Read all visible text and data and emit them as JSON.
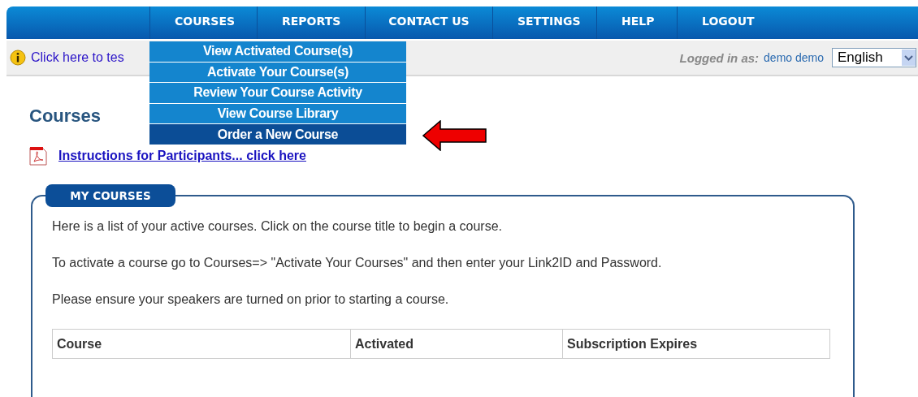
{
  "nav": {
    "items": [
      {
        "label": "COURSES",
        "menu": [
          {
            "label": "View Activated Course(s)",
            "selected": false
          },
          {
            "label": "Activate Your Course(s)",
            "selected": false
          },
          {
            "label": "Review Your Course Activity",
            "selected": false
          },
          {
            "label": "View Course Library",
            "selected": false
          },
          {
            "label": "Order a New Course",
            "selected": true
          }
        ]
      },
      {
        "label": "REPORTS"
      },
      {
        "label": "CONTACT US"
      },
      {
        "label": "SETTINGS"
      },
      {
        "label": "HELP"
      },
      {
        "label": "LOGOUT"
      }
    ]
  },
  "info_bar": {
    "notice": "Click here to tes",
    "logged_in_label": "Logged in as:",
    "user": "demo demo",
    "language": {
      "value": "English"
    }
  },
  "annotation": {
    "kind": "arrow"
  },
  "page": {
    "heading": "Courses",
    "instructions_link": "Instructions for Participants... click here"
  },
  "my_courses": {
    "tab": "MY COURSES",
    "paragraphs": [
      "Here is a list of your active courses. Click on the course title to begin a course.",
      "To activate a course go to Courses=> \"Activate Your Courses\" and then enter your Link2ID and Password.",
      "Please ensure your speakers are turned on prior to starting a course."
    ],
    "table": {
      "columns": [
        "Course",
        "Activated",
        "Subscription Expires"
      ]
    }
  }
}
